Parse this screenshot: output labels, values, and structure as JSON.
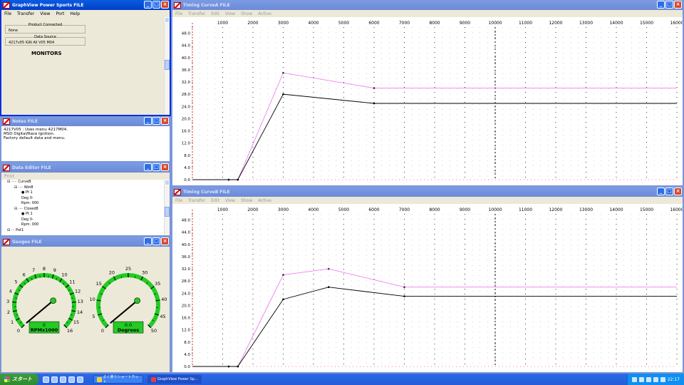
{
  "windows": {
    "main": {
      "title": "GraphView Power Sports FILE",
      "menu": [
        "File",
        "Transfer",
        "View",
        "Port",
        "Help"
      ],
      "product_connected_label": "Product Connected",
      "product_connected_value": "None",
      "data_source_label": "Data Source",
      "data_source_value": "4217v05 IGN All V05 M04",
      "monitors_label": "MONITORS"
    },
    "notes": {
      "title": "Notes   FILE",
      "lines": [
        "4217V05 : Uses menu 4217M04.",
        "MSD Digital/Race Ignition.",
        "Factory default data and menu."
      ]
    },
    "data_editor": {
      "title": "Data Editor   FILE",
      "menu": [
        "Print"
      ],
      "tree": [
        {
          "indent": 0,
          "text": "⊟ ····· CurveB"
        },
        {
          "indent": 1,
          "text": "⊟ ···· Wot8"
        },
        {
          "indent": 2,
          "text": "● Pt 1"
        },
        {
          "indent": 2,
          "text": "Deg 0-"
        },
        {
          "indent": 2,
          "text": "Rpm: 000"
        },
        {
          "indent": 1,
          "text": "⊟ ···· Closed8"
        },
        {
          "indent": 2,
          "text": "● Pt 1"
        },
        {
          "indent": 2,
          "text": "Deg 0-"
        },
        {
          "indent": 2,
          "text": "Rpm: 000"
        },
        {
          "indent": 0,
          "text": "⊟ ··· Pot1"
        }
      ]
    },
    "gauges": {
      "title": "Gauges   FILE",
      "rpm": {
        "value": "0",
        "unit": "RPMx1000",
        "ticks": [
          "0",
          "1",
          "2",
          "3",
          "4",
          "5",
          "6",
          "7",
          "8",
          "9",
          "10",
          "11",
          "12",
          "13",
          "14",
          "15",
          "16"
        ],
        "max": 16
      },
      "deg": {
        "value": "0.0",
        "unit": "Degrees",
        "ticks": [
          "0",
          "5",
          "10",
          "15",
          "20",
          "25",
          "30",
          "35",
          "40",
          "45",
          "50"
        ],
        "max": 50
      }
    },
    "curve_a": {
      "title": "Timing CurveA   FILE",
      "menu": [
        "File",
        "Transfer",
        "Edit",
        "View",
        "Show",
        "Active"
      ]
    },
    "curve_b": {
      "title": "Timing CurveB   FILE",
      "menu": [
        "File",
        "Transfer",
        "Edit",
        "View",
        "Show",
        "Active"
      ]
    }
  },
  "chart_data": [
    {
      "type": "line",
      "x_ticks": [
        "1000",
        "2000",
        "3000",
        "4000",
        "5000",
        "6000",
        "7000",
        "8000",
        "9000",
        "10000",
        "11000",
        "12000",
        "13000",
        "14000",
        "15000",
        "16000"
      ],
      "y_ticks": [
        "0.0",
        "4.0",
        "8.0",
        "12.0",
        "16.0",
        "20.0",
        "24.0",
        "28.0",
        "32.0",
        "36.0",
        "40.0",
        "44.0",
        "48.0"
      ],
      "xlim": [
        0,
        16000
      ],
      "ylim": [
        0,
        50
      ],
      "series": [
        {
          "color": "#ee82ee",
          "x": [
            0,
            1200,
            1500,
            3000,
            6000,
            16000
          ],
          "y": [
            0,
            0,
            0,
            35,
            30,
            30
          ]
        },
        {
          "color": "#000000",
          "x": [
            0,
            1200,
            1500,
            3000,
            6000,
            16000
          ],
          "y": [
            0,
            0,
            0,
            28,
            25,
            25
          ]
        }
      ]
    },
    {
      "type": "line",
      "x_ticks": [
        "1000",
        "2000",
        "3000",
        "4000",
        "5000",
        "6000",
        "7000",
        "8000",
        "9000",
        "10000",
        "11000",
        "12000",
        "13000",
        "14000",
        "15000",
        "16000"
      ],
      "y_ticks": [
        "0.0",
        "4.0",
        "8.0",
        "12.0",
        "16.0",
        "20.0",
        "24.0",
        "28.0",
        "32.0",
        "36.0",
        "40.0",
        "44.0",
        "48.0"
      ],
      "xlim": [
        0,
        16000
      ],
      "ylim": [
        0,
        50
      ],
      "series": [
        {
          "color": "#ee82ee",
          "x": [
            0,
            1200,
            1500,
            3000,
            4500,
            7000,
            16000
          ],
          "y": [
            0,
            0,
            0,
            30,
            32,
            26,
            26
          ]
        },
        {
          "color": "#000000",
          "x": [
            0,
            1200,
            1500,
            3000,
            4500,
            7000,
            16000
          ],
          "y": [
            0,
            0,
            0,
            22,
            26,
            23,
            23
          ]
        }
      ]
    }
  ],
  "taskbar": {
    "start": "スタート",
    "tasks": [
      "よく使うショートカット",
      "GraphView Power Sp..."
    ],
    "clock": "22:17"
  }
}
